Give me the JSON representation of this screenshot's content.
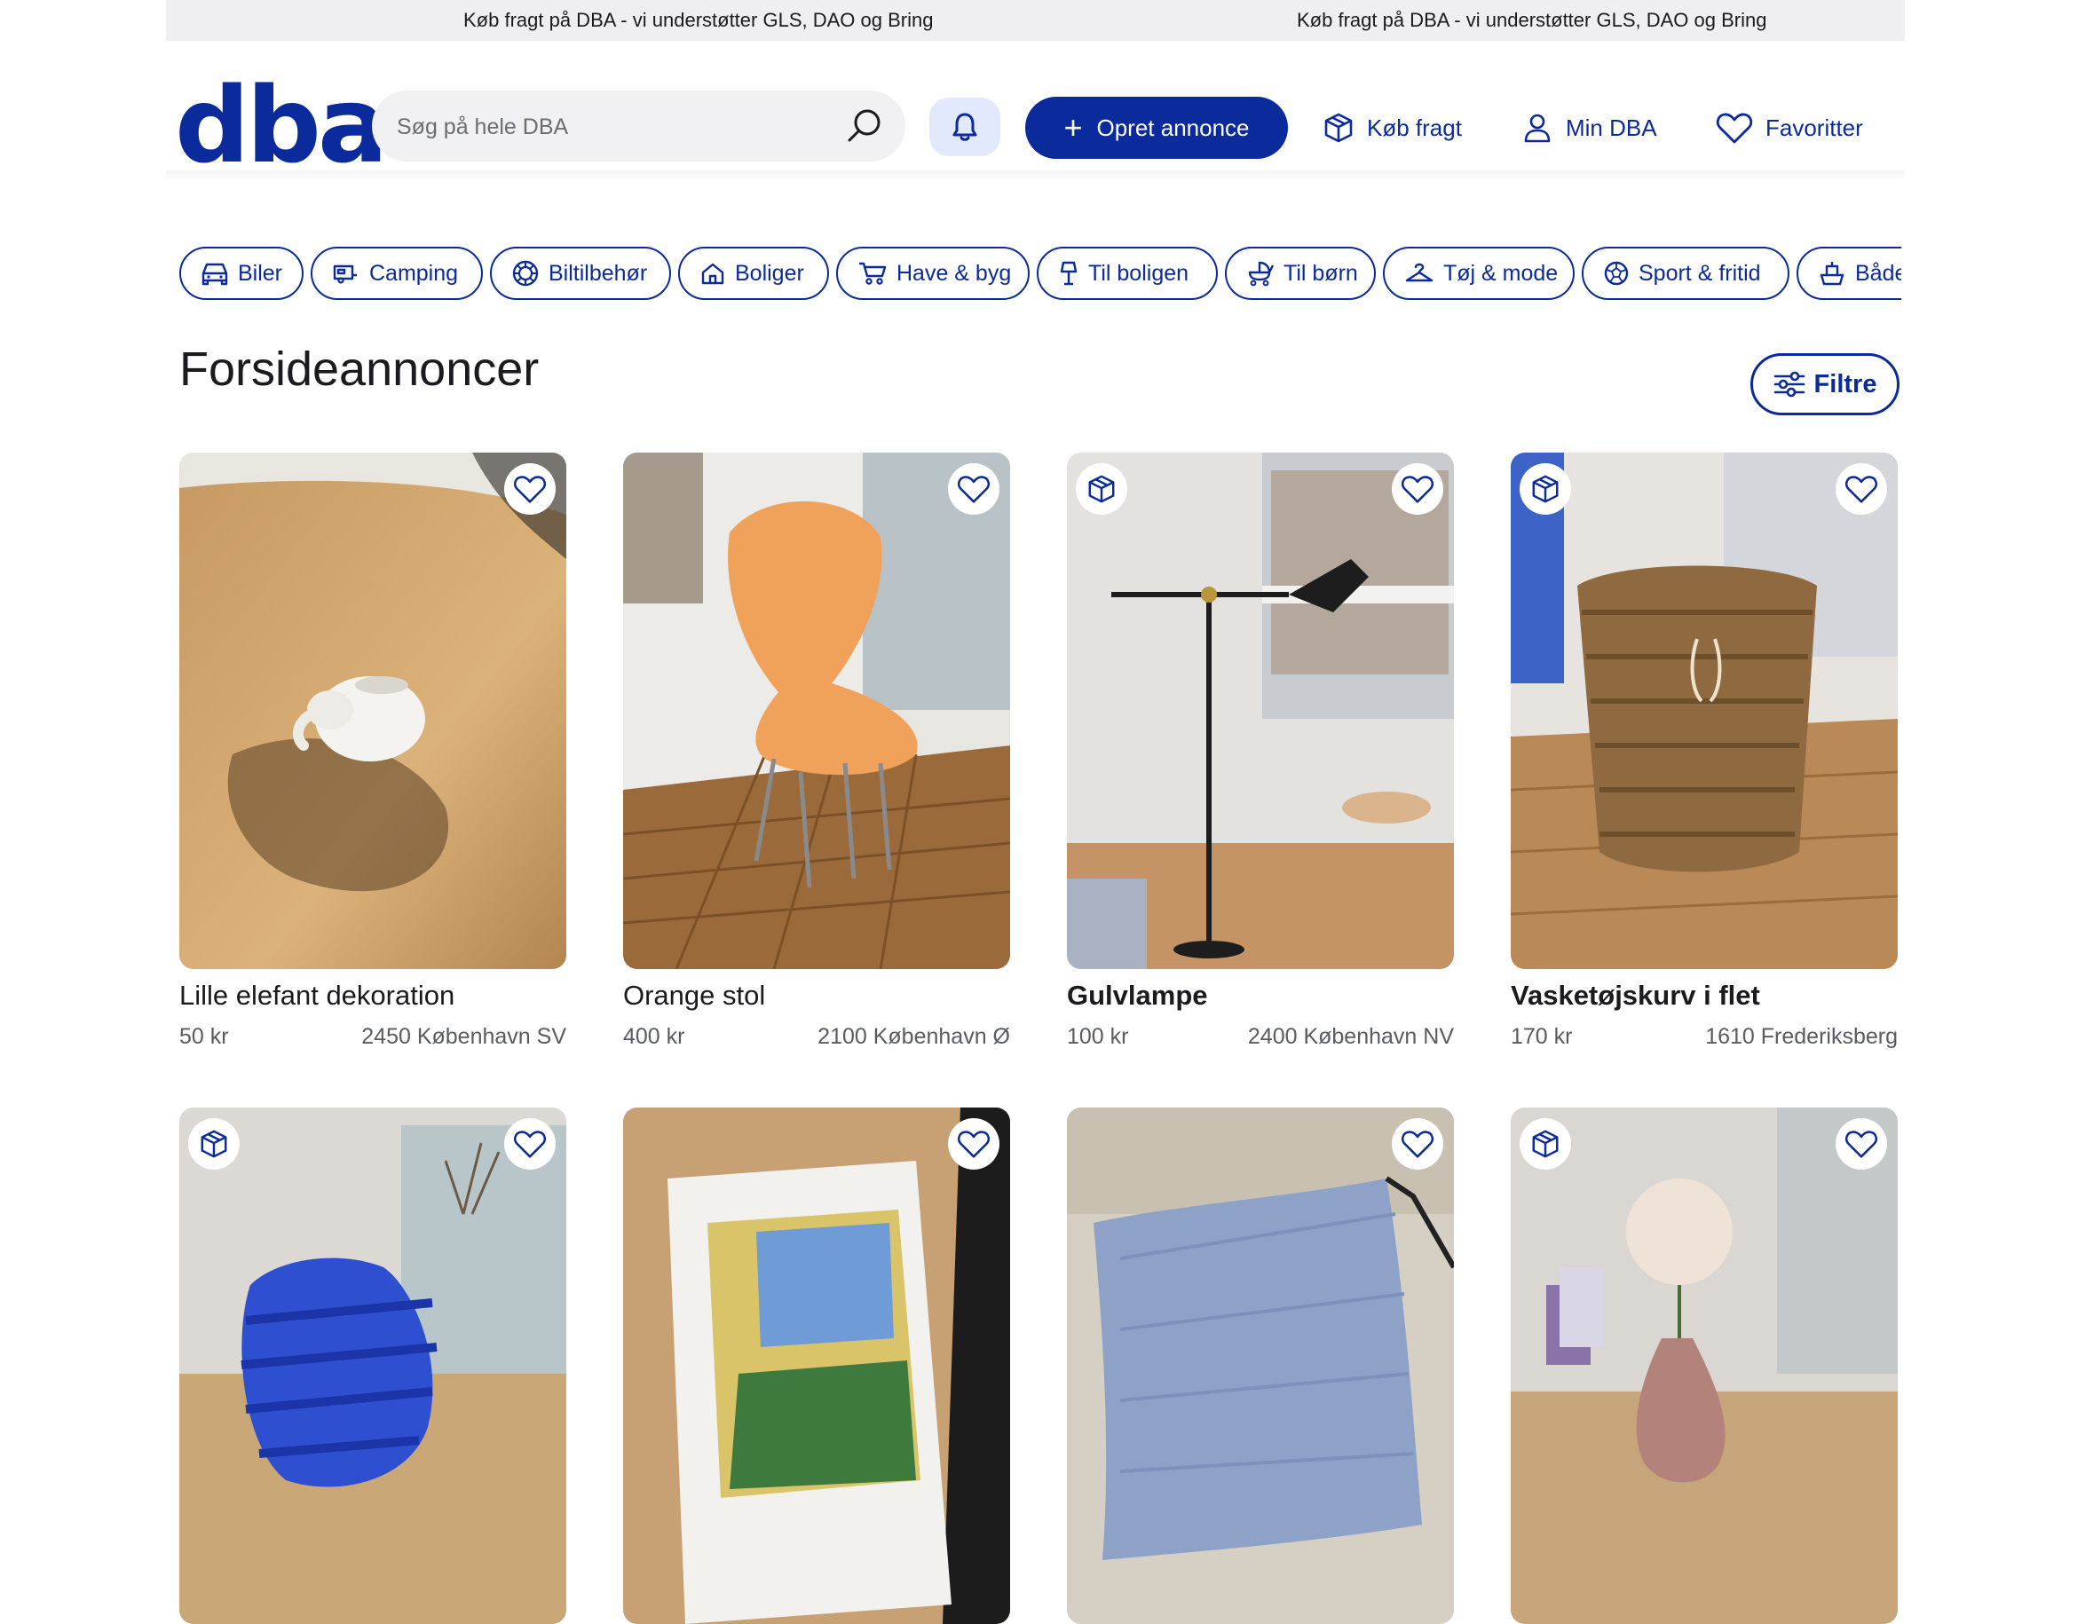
{
  "banner": {
    "messages": [
      "Køb fragt på DBA - vi understøtter GLS, DAO og Bring",
      "Køb fragt på DBA - vi understøtter GLS, DAO og Bring"
    ]
  },
  "header": {
    "logo": "dba",
    "search_placeholder": "Søg på hele DBA",
    "create_label": "Opret annonce",
    "buy_freight_label": "Køb fragt",
    "my_dba_label": "Min DBA",
    "favorites_label": "Favoritter"
  },
  "categories": [
    {
      "label": "Biler",
      "icon": "car-icon"
    },
    {
      "label": "Camping",
      "icon": "camper-icon"
    },
    {
      "label": "Biltilbehør",
      "icon": "wheel-icon"
    },
    {
      "label": "Boliger",
      "icon": "house-icon"
    },
    {
      "label": "Have & byg",
      "icon": "wheelbarrow-icon"
    },
    {
      "label": "Til boligen",
      "icon": "lamp-icon"
    },
    {
      "label": "Til børn",
      "icon": "stroller-icon"
    },
    {
      "label": "Tøj & mode",
      "icon": "hanger-icon"
    },
    {
      "label": "Sport & fritid",
      "icon": "ball-icon"
    },
    {
      "label": "Både",
      "icon": "boat-icon"
    }
  ],
  "main": {
    "title": "Forsideannoncer",
    "filter_label": "Filtre"
  },
  "listings": [
    {
      "title": "Lille elefant dekoration",
      "price": "50 kr",
      "location": "2450 København SV",
      "shipping": false
    },
    {
      "title": "Orange stol",
      "price": "400 kr",
      "location": "2100 København Ø",
      "shipping": false
    },
    {
      "title": "Gulvlampe",
      "price": "100 kr",
      "location": "2400 København NV",
      "shipping": true
    },
    {
      "title": "Vasketøjskurv i flet",
      "price": "170 kr",
      "location": "1610 Frederiksberg",
      "shipping": true
    },
    {
      "title": "",
      "price": "",
      "location": "",
      "shipping": true
    },
    {
      "title": "",
      "price": "",
      "location": "",
      "shipping": false
    },
    {
      "title": "",
      "price": "",
      "location": "",
      "shipping": false
    },
    {
      "title": "",
      "price": "",
      "location": "",
      "shipping": true
    }
  ],
  "colors": {
    "brand": "#0b2a9c",
    "banner_bg": "#efeff1",
    "bell_bg": "#e2e9fd"
  }
}
